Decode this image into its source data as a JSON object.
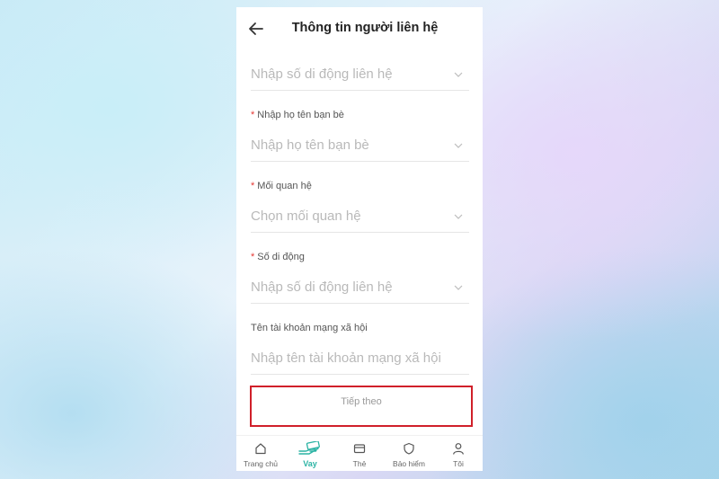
{
  "header": {
    "title": "Thông tin người liên hệ",
    "back_icon": "arrow-left-icon"
  },
  "form": {
    "phone_field_top": {
      "placeholder": "Nhập số di động liên hệ"
    },
    "friend_name": {
      "label": "Nhập họ tên bạn bè",
      "required": true,
      "placeholder": "Nhập họ tên bạn bè"
    },
    "relationship": {
      "label": "Mối quan hệ",
      "required": true,
      "placeholder": "Chọn mối quan hệ"
    },
    "mobile": {
      "label": "Số di động",
      "required": true,
      "placeholder": "Nhập số di động liên hệ"
    },
    "social_account": {
      "label": "Tên tài khoản mạng xã hội",
      "required": false,
      "placeholder": "Nhập tên tài khoản mạng xã hội"
    },
    "required_marker": "*"
  },
  "next_button": {
    "label": "Tiếp theo"
  },
  "tabbar": {
    "active_color": "#2bb3a4",
    "items": [
      {
        "label": "Trang chủ",
        "icon": "home-icon"
      },
      {
        "label": "Vay",
        "icon": "loan-hand-icon",
        "active": true
      },
      {
        "label": "Thẻ",
        "icon": "card-icon"
      },
      {
        "label": "Bảo hiểm",
        "icon": "shield-icon"
      },
      {
        "label": "Tôi",
        "icon": "user-icon"
      }
    ]
  },
  "colors": {
    "highlight_border": "#d0202a",
    "required_star": "#e53935",
    "placeholder": "#b9b9b9"
  }
}
